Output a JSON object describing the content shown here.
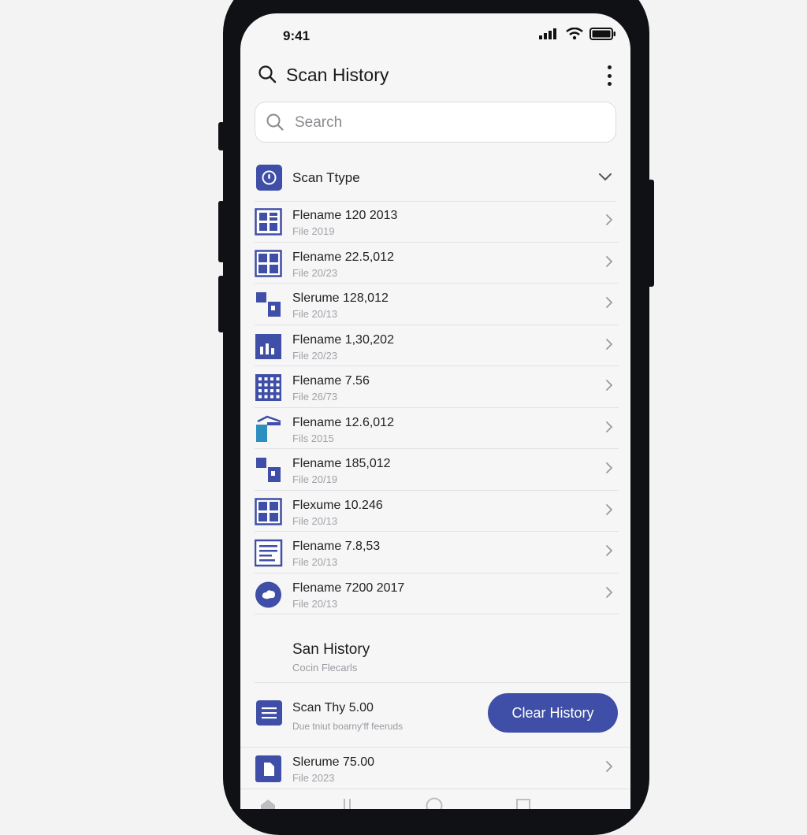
{
  "status_bar": {
    "time": "9:41"
  },
  "header": {
    "title": "Scan History"
  },
  "search": {
    "placeholder": "Search"
  },
  "filter": {
    "label": "Scan Ttype"
  },
  "items": [
    {
      "title": "Flename 120 2013",
      "subtitle": "File 2019",
      "icon": "grid-doc-icon"
    },
    {
      "title": "Flename 22.5,012",
      "subtitle": "File 20/23",
      "icon": "grid-icon"
    },
    {
      "title": "Slerume 128,012",
      "subtitle": "File 20/13",
      "icon": "blocks-icon"
    },
    {
      "title": "Flename 1,30,202",
      "subtitle": "File 20/23",
      "icon": "chart-doc-icon"
    },
    {
      "title": "Flename 7.56",
      "subtitle": "File 26/73",
      "icon": "dots-grid-icon"
    },
    {
      "title": "Flename 12.6,012",
      "subtitle": "Fils 2015",
      "icon": "scanner-icon"
    },
    {
      "title": "Flename 185,012",
      "subtitle": "File 20/19",
      "icon": "blocks-icon"
    },
    {
      "title": "Flexume 10.246",
      "subtitle": "File 20/13",
      "icon": "grid-icon"
    },
    {
      "title": "Flename 7.8,53",
      "subtitle": "File 20/13",
      "icon": "text-doc-icon"
    },
    {
      "title": "Flename 7200 2017",
      "subtitle": "File 20/13",
      "icon": "cloud-icon"
    }
  ],
  "section": {
    "title": "San History",
    "subtitle": "Cocin Flecarls"
  },
  "summary": {
    "title": "Scan Thy 5.00",
    "subtitle": "Due tniut boarny'ff feeruds",
    "button_label": "Clear History"
  },
  "last_item": {
    "title": "Slerume 75.00",
    "subtitle": "File 2023",
    "icon": "document-icon"
  },
  "colors": {
    "accent": "#3f4ea6",
    "background": "#f6f6f7",
    "divider": "#e2e2e5"
  }
}
